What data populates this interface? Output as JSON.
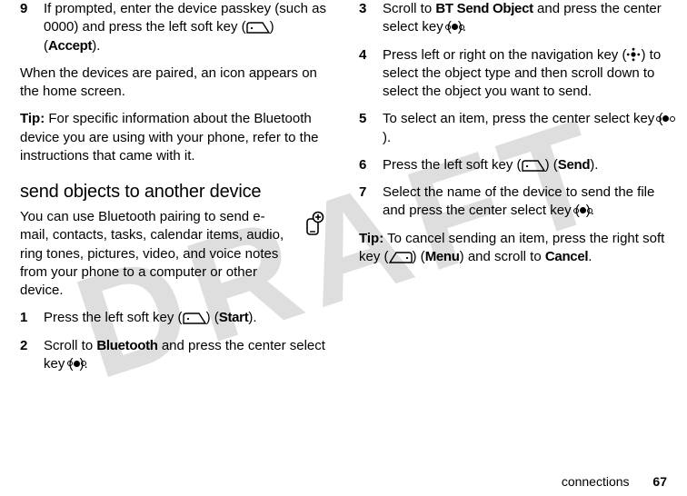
{
  "watermark": "DRAFT",
  "footer": {
    "section": "connections",
    "page": "67"
  },
  "left": {
    "step9": {
      "num": "9",
      "text_a": "If prompted, enter the device passkey (such as 0000) and press the left soft key (",
      "text_b": ") (",
      "accept": "Accept",
      "text_c": ")."
    },
    "paired": "When the devices are paired, an icon appears on the home screen.",
    "tip_label": "Tip:",
    "tip_text": " For specific information about the Bluetooth device you are using with your phone, refer to the instructions that came with it.",
    "heading": "send objects to another device",
    "intro": "You can use Bluetooth pairing to send e-mail, contacts, tasks, calendar items, audio, ring tones, pictures, video, and voice notes from your phone to a computer or other device.",
    "step1": {
      "num": "1",
      "a": "Press the left soft key (",
      "b": ") (",
      "start": "Start",
      "c": ")."
    },
    "step2": {
      "num": "2",
      "a": "Scroll to ",
      "bluetooth": "Bluetooth",
      "b": " and press the center select key (",
      "c": ")."
    }
  },
  "right": {
    "step3": {
      "num": "3",
      "a": "Scroll to ",
      "btsend": "BT Send Object",
      "b": " and press the center select key (",
      "c": ")."
    },
    "step4": {
      "num": "4",
      "a": "Press left or right on the navigation key (",
      "b": ") to select the object type and then scroll down to select the object you want to send."
    },
    "step5": {
      "num": "5",
      "a": "To select an item, press the center select key (",
      "b": ")."
    },
    "step6": {
      "num": "6",
      "a": "Press the left soft key (",
      "b": ") (",
      "send": "Send",
      "c": ")."
    },
    "step7": {
      "num": "7",
      "a": "Select the name of the device to send the file and press the center select key (",
      "b": ")."
    },
    "tip_label": "Tip:",
    "tip_a": " To cancel sending an item, press the right soft key (",
    "tip_b": ") (",
    "menu": "Menu",
    "tip_c": ") and scroll to  ",
    "cancel": "Cancel",
    "tip_d": "."
  }
}
